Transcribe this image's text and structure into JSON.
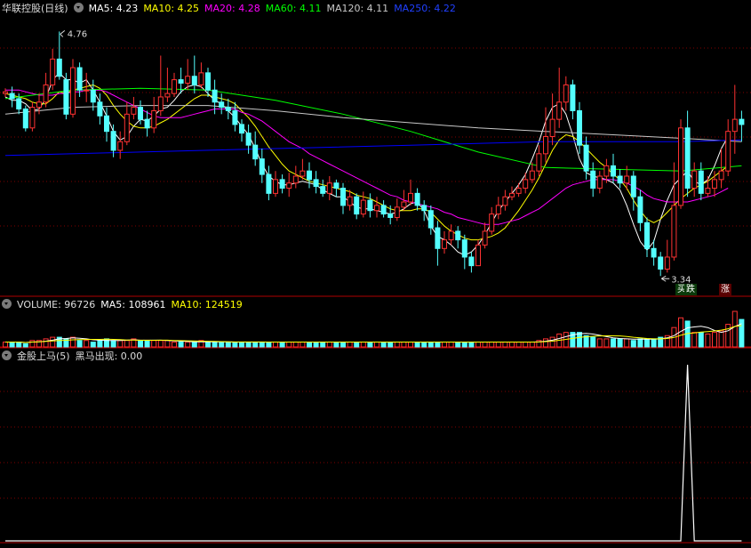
{
  "header_main": {
    "stock": "华联控股(日线)",
    "ma5": "MA5: 4.23",
    "ma10": "MA10: 4.25",
    "ma20": "MA20: 4.28",
    "ma60": "MA60: 4.11",
    "ma120": "MA120: 4.11",
    "ma250": "MA250: 4.22"
  },
  "header_volume": {
    "label": "VOLUME: 96726",
    "ma5": "MA5: 108961",
    "ma10": "MA10: 124519"
  },
  "header_indicator": {
    "label": "金股上马(5)",
    "value": "黑马出现: 0.00"
  },
  "annotations": {
    "high": "4.76",
    "low": "3.34",
    "buy": "买",
    "fall": "跌",
    "rise": "涨"
  },
  "colors": {
    "up": "#ff3232",
    "down": "#54ffff",
    "ma5": "#ffffff",
    "ma10": "#ffff00",
    "ma20": "#ff00ff",
    "ma60": "#00ff00",
    "ma120": "#c8c8c8",
    "ma250": "#0000ff",
    "grid": "#800000",
    "label": "#dddddd"
  },
  "chart_data": [
    {
      "type": "candlestick",
      "title": "华联控股(日线)",
      "ylim": [
        3.3,
        4.85
      ],
      "high_label": 4.76,
      "low_label": 3.34,
      "candles": [
        [
          4.4,
          4.41,
          4.38,
          4.43
        ],
        [
          4.4,
          4.37,
          4.32,
          4.44
        ],
        [
          4.37,
          4.31,
          4.28,
          4.4
        ],
        [
          4.31,
          4.2,
          4.18,
          4.33
        ],
        [
          4.2,
          4.32,
          4.18,
          4.35
        ],
        [
          4.32,
          4.35,
          4.28,
          4.4
        ],
        [
          4.35,
          4.45,
          4.32,
          4.52
        ],
        [
          4.45,
          4.6,
          4.42,
          4.66
        ],
        [
          4.6,
          4.5,
          4.48,
          4.76
        ],
        [
          4.48,
          4.28,
          4.25,
          4.52
        ],
        [
          4.28,
          4.55,
          4.26,
          4.6
        ],
        [
          4.55,
          4.42,
          4.38,
          4.58
        ],
        [
          4.42,
          4.42,
          4.35,
          4.52
        ],
        [
          4.42,
          4.35,
          4.3,
          4.48
        ],
        [
          4.35,
          4.27,
          4.22,
          4.4
        ],
        [
          4.27,
          4.18,
          4.12,
          4.32
        ],
        [
          4.18,
          4.07,
          4.03,
          4.22
        ],
        [
          4.07,
          4.12,
          4.02,
          4.18
        ],
        [
          4.12,
          4.28,
          4.1,
          4.35
        ],
        [
          4.28,
          4.32,
          4.25,
          4.38
        ],
        [
          4.32,
          4.25,
          4.22,
          4.36
        ],
        [
          4.25,
          4.2,
          4.15,
          4.3
        ],
        [
          4.2,
          4.3,
          4.17,
          4.38
        ],
        [
          4.3,
          4.38,
          4.27,
          4.62
        ],
        [
          4.38,
          4.4,
          4.35,
          4.55
        ],
        [
          4.4,
          4.48,
          4.38,
          4.52
        ],
        [
          4.48,
          4.46,
          4.4,
          4.55
        ],
        [
          4.46,
          4.5,
          4.42,
          4.6
        ],
        [
          4.5,
          4.45,
          4.4,
          4.62
        ],
        [
          4.45,
          4.52,
          4.43,
          4.58
        ],
        [
          4.52,
          4.42,
          4.38,
          4.55
        ],
        [
          4.42,
          4.35,
          4.28,
          4.48
        ],
        [
          4.35,
          4.32,
          4.28,
          4.4
        ],
        [
          4.32,
          4.3,
          4.25,
          4.37
        ],
        [
          4.3,
          4.22,
          4.18,
          4.35
        ],
        [
          4.22,
          4.17,
          4.12,
          4.25
        ],
        [
          4.17,
          4.1,
          4.05,
          4.22
        ],
        [
          4.1,
          4.02,
          3.98,
          4.18
        ],
        [
          4.02,
          3.93,
          3.88,
          4.08
        ],
        [
          3.93,
          3.82,
          3.78,
          3.98
        ],
        [
          3.82,
          3.9,
          3.8,
          3.95
        ],
        [
          3.9,
          3.85,
          3.82,
          3.93
        ],
        [
          3.85,
          3.88,
          3.8,
          3.94
        ],
        [
          3.88,
          3.92,
          3.85,
          3.98
        ],
        [
          3.92,
          3.95,
          3.9,
          4.02
        ],
        [
          3.95,
          3.9,
          3.85,
          4.0
        ],
        [
          3.9,
          3.86,
          3.82,
          3.95
        ],
        [
          3.86,
          3.82,
          3.8,
          3.9
        ],
        [
          3.82,
          3.88,
          3.78,
          3.92
        ],
        [
          3.88,
          3.85,
          3.8,
          3.9
        ],
        [
          3.85,
          3.75,
          3.7,
          3.88
        ],
        [
          3.75,
          3.8,
          3.72,
          3.84
        ],
        [
          3.8,
          3.7,
          3.67,
          3.82
        ],
        [
          3.7,
          3.78,
          3.68,
          3.83
        ],
        [
          3.78,
          3.72,
          3.68,
          3.82
        ],
        [
          3.72,
          3.75,
          3.68,
          3.8
        ],
        [
          3.75,
          3.7,
          3.68,
          3.78
        ],
        [
          3.7,
          3.68,
          3.64,
          3.75
        ],
        [
          3.68,
          3.74,
          3.66,
          3.79
        ],
        [
          3.74,
          3.77,
          3.72,
          3.84
        ],
        [
          3.77,
          3.82,
          3.75,
          3.9
        ],
        [
          3.82,
          3.75,
          3.72,
          3.85
        ],
        [
          3.75,
          3.72,
          3.66,
          3.78
        ],
        [
          3.72,
          3.62,
          3.58,
          3.75
        ],
        [
          3.62,
          3.5,
          3.4,
          3.66
        ],
        [
          3.5,
          3.55,
          3.47,
          3.6
        ],
        [
          3.55,
          3.6,
          3.52,
          3.64
        ],
        [
          3.6,
          3.55,
          3.5,
          3.63
        ],
        [
          3.55,
          3.45,
          3.38,
          3.58
        ],
        [
          3.45,
          3.4,
          3.36,
          3.48
        ],
        [
          3.4,
          3.52,
          3.4,
          3.55
        ],
        [
          3.52,
          3.6,
          3.5,
          3.65
        ],
        [
          3.6,
          3.7,
          3.58,
          3.74
        ],
        [
          3.7,
          3.75,
          3.67,
          3.8
        ],
        [
          3.75,
          3.8,
          3.72,
          3.84
        ],
        [
          3.8,
          3.82,
          3.78,
          3.86
        ],
        [
          3.82,
          3.85,
          3.8,
          3.88
        ],
        [
          3.85,
          3.9,
          3.82,
          3.94
        ],
        [
          3.9,
          3.95,
          3.88,
          4.0
        ],
        [
          3.95,
          4.05,
          3.92,
          4.1
        ],
        [
          4.05,
          4.15,
          4.0,
          4.32
        ],
        [
          4.15,
          4.25,
          4.1,
          4.4
        ],
        [
          4.25,
          4.35,
          4.2,
          4.55
        ],
        [
          4.35,
          4.45,
          4.3,
          4.5
        ],
        [
          4.45,
          4.3,
          4.25,
          4.48
        ],
        [
          4.3,
          4.1,
          4.05,
          4.35
        ],
        [
          4.1,
          3.95,
          3.9,
          4.15
        ],
        [
          3.95,
          3.85,
          3.8,
          4.0
        ],
        [
          3.85,
          3.92,
          3.82,
          3.95
        ],
        [
          3.92,
          3.98,
          3.88,
          4.02
        ],
        [
          3.98,
          3.92,
          3.88,
          4.05
        ],
        [
          3.92,
          3.88,
          3.85,
          3.96
        ],
        [
          3.88,
          3.92,
          3.84,
          3.98
        ],
        [
          3.92,
          3.8,
          3.72,
          3.95
        ],
        [
          3.8,
          3.65,
          3.6,
          3.84
        ],
        [
          3.65,
          3.5,
          3.45,
          3.68
        ],
        [
          3.5,
          3.45,
          3.4,
          3.55
        ],
        [
          3.45,
          3.38,
          3.34,
          3.48
        ],
        [
          3.38,
          3.45,
          3.36,
          3.55
        ],
        [
          3.45,
          3.75,
          3.43,
          4.0
        ],
        [
          3.75,
          4.2,
          3.73,
          4.25
        ],
        [
          4.2,
          3.85,
          3.8,
          4.3
        ],
        [
          3.85,
          3.95,
          3.8,
          4.0
        ],
        [
          3.95,
          3.82,
          3.78,
          4.0
        ],
        [
          3.82,
          3.85,
          3.8,
          3.92
        ],
        [
          3.85,
          3.9,
          3.8,
          3.95
        ],
        [
          3.9,
          3.95,
          3.85,
          4.08
        ],
        [
          3.95,
          4.18,
          3.92,
          4.25
        ],
        [
          4.18,
          4.25,
          4.05,
          4.45
        ],
        [
          4.25,
          4.22,
          4.12,
          4.3
        ]
      ],
      "ma": {
        "MA5": [
          4.38,
          4.36,
          4.36,
          4.34,
          4.3,
          4.31,
          4.37,
          4.48,
          4.52,
          4.48,
          4.48,
          4.46,
          4.48,
          4.42,
          4.35,
          4.27,
          4.18,
          4.13,
          4.15,
          4.21,
          4.25,
          4.24,
          4.27,
          4.31,
          4.32,
          4.36,
          4.41,
          4.44,
          4.45,
          4.44,
          4.4,
          4.36,
          4.34,
          4.3,
          4.26,
          4.21,
          4.16,
          4.08,
          3.99,
          3.92,
          3.89,
          3.87,
          3.87,
          3.88,
          3.89,
          3.88,
          3.87,
          3.84,
          3.82,
          3.8,
          3.8,
          3.77,
          3.74,
          3.73,
          3.73,
          3.72,
          3.71,
          3.7,
          3.71,
          3.73,
          3.76,
          3.77,
          3.72,
          3.63,
          3.57,
          3.55,
          3.52,
          3.48,
          3.46,
          3.48,
          3.52,
          3.58,
          3.65,
          3.72,
          3.77,
          3.82,
          3.87,
          3.93,
          4.02,
          4.12,
          4.24,
          4.32,
          4.34,
          4.28,
          4.16,
          4.02,
          3.94,
          3.92,
          3.91,
          3.9,
          3.88,
          3.84,
          3.75,
          3.64,
          3.54,
          3.49,
          3.54,
          3.67,
          3.78,
          3.87,
          3.91,
          3.95,
          3.89,
          3.87,
          3.9,
          3.98,
          4.08,
          4.15
        ],
        "MA10": [
          4.4,
          4.39,
          4.38,
          4.37,
          4.35,
          4.34,
          4.34,
          4.37,
          4.41,
          4.4,
          4.42,
          4.43,
          4.44,
          4.45,
          4.43,
          4.39,
          4.33,
          4.28,
          4.24,
          4.21,
          4.2,
          4.2,
          4.21,
          4.23,
          4.25,
          4.28,
          4.31,
          4.34,
          4.37,
          4.39,
          4.39,
          4.38,
          4.37,
          4.36,
          4.34,
          4.3,
          4.26,
          4.21,
          4.15,
          4.09,
          4.04,
          3.99,
          3.95,
          3.93,
          3.91,
          3.89,
          3.88,
          3.87,
          3.86,
          3.85,
          3.84,
          3.83,
          3.81,
          3.8,
          3.79,
          3.77,
          3.75,
          3.73,
          3.72,
          3.72,
          3.72,
          3.73,
          3.73,
          3.71,
          3.67,
          3.63,
          3.6,
          3.58,
          3.56,
          3.55,
          3.55,
          3.56,
          3.57,
          3.59,
          3.62,
          3.67,
          3.72,
          3.78,
          3.84,
          3.91,
          3.99,
          4.07,
          4.13,
          4.16,
          4.15,
          4.12,
          4.08,
          4.04,
          4.0,
          3.97,
          3.93,
          3.9,
          3.85,
          3.78,
          3.72,
          3.67,
          3.65,
          3.67,
          3.71,
          3.75,
          3.79,
          3.82,
          3.85,
          3.87,
          3.89,
          3.92,
          3.95,
          3.98
        ],
        "MA20": [
          4.42,
          4.42,
          4.42,
          4.41,
          4.4,
          4.39,
          4.39,
          4.39,
          4.4,
          4.4,
          4.41,
          4.41,
          4.42,
          4.42,
          4.42,
          4.41,
          4.39,
          4.37,
          4.35,
          4.33,
          4.31,
          4.29,
          4.27,
          4.26,
          4.26,
          4.26,
          4.26,
          4.27,
          4.28,
          4.29,
          4.3,
          4.31,
          4.31,
          4.31,
          4.31,
          4.29,
          4.28,
          4.26,
          4.24,
          4.21,
          4.18,
          4.15,
          4.12,
          4.1,
          4.08,
          4.05,
          4.03,
          4.01,
          3.99,
          3.97,
          3.95,
          3.93,
          3.91,
          3.89,
          3.87,
          3.85,
          3.83,
          3.81,
          3.8,
          3.78,
          3.77,
          3.76,
          3.75,
          3.74,
          3.73,
          3.71,
          3.7,
          3.68,
          3.67,
          3.66,
          3.65,
          3.64,
          3.64,
          3.64,
          3.65,
          3.66,
          3.67,
          3.69,
          3.71,
          3.73,
          3.76,
          3.79,
          3.82,
          3.85,
          3.87,
          3.88,
          3.89,
          3.9,
          3.9,
          3.9,
          3.9,
          3.89,
          3.88,
          3.86,
          3.84,
          3.81,
          3.79,
          3.78,
          3.77,
          3.77,
          3.77,
          3.77,
          3.78,
          3.79,
          3.8,
          3.81,
          3.83,
          3.85
        ]
      },
      "ma_lines_smooth": {
        "MA60": [
          [
            0,
            4.37
          ],
          [
            10,
            4.42
          ],
          [
            20,
            4.43
          ],
          [
            30,
            4.42
          ],
          [
            40,
            4.36
          ],
          [
            50,
            4.28
          ],
          [
            60,
            4.18
          ],
          [
            70,
            4.06
          ],
          [
            80,
            3.97
          ],
          [
            90,
            3.96
          ],
          [
            100,
            3.95
          ],
          [
            109,
            3.98
          ]
        ],
        "MA120": [
          [
            0,
            4.28
          ],
          [
            10,
            4.32
          ],
          [
            20,
            4.33
          ],
          [
            30,
            4.33
          ],
          [
            40,
            4.3
          ],
          [
            50,
            4.26
          ],
          [
            60,
            4.23
          ],
          [
            70,
            4.2
          ],
          [
            80,
            4.18
          ],
          [
            90,
            4.16
          ],
          [
            100,
            4.14
          ],
          [
            109,
            4.12
          ]
        ],
        "MA250": [
          [
            0,
            4.04
          ],
          [
            20,
            4.06
          ],
          [
            40,
            4.08
          ],
          [
            60,
            4.1
          ],
          [
            80,
            4.12
          ],
          [
            100,
            4.12
          ],
          [
            109,
            4.13
          ]
        ]
      }
    },
    {
      "type": "bar",
      "title": "VOLUME",
      "values": [
        3,
        3,
        3,
        2,
        4,
        4,
        5,
        6,
        6,
        5,
        6,
        4,
        4,
        3,
        4,
        5,
        4,
        4,
        4,
        5,
        4,
        4,
        4,
        4,
        4,
        3,
        3,
        3,
        3,
        4,
        3,
        3,
        3,
        3,
        3,
        3,
        3,
        3,
        3,
        3,
        3,
        3,
        3,
        3,
        3,
        3,
        3,
        3,
        3,
        3,
        3,
        3,
        3,
        3,
        3,
        3,
        3,
        3,
        3,
        3,
        3,
        3,
        3,
        3,
        3,
        3,
        3,
        3,
        3,
        3,
        3,
        3,
        3,
        3,
        3,
        3,
        3,
        3,
        3,
        4,
        5,
        6,
        8,
        9,
        9,
        9,
        7,
        6,
        5,
        5,
        5,
        5,
        5,
        4,
        5,
        5,
        5,
        6,
        7,
        12,
        18,
        16,
        9,
        9,
        8,
        9,
        10,
        14,
        22,
        17
      ]
    },
    {
      "type": "line",
      "title": "金股上马(5)",
      "series": [
        {
          "name": "黑马出现",
          "x": [
            0,
            100,
            101,
            102,
            109
          ],
          "values": [
            0,
            0,
            1,
            0,
            0
          ]
        }
      ],
      "ylim": [
        0,
        1
      ]
    }
  ]
}
